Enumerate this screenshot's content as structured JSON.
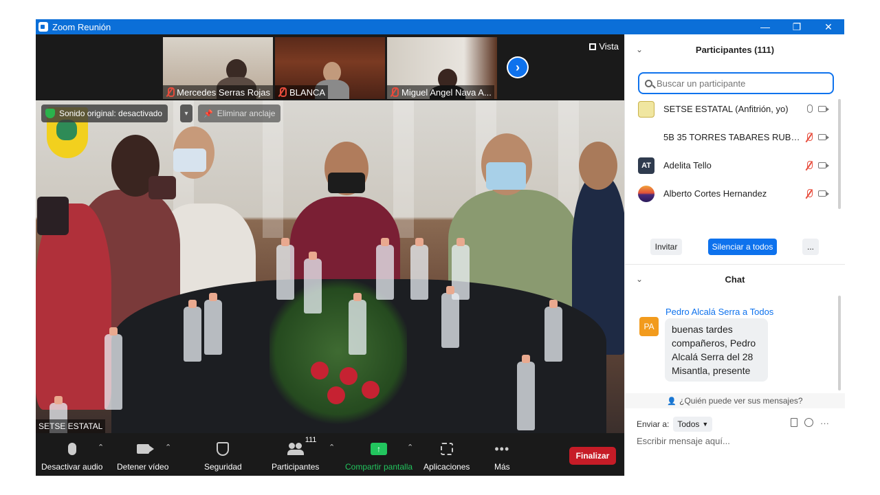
{
  "window": {
    "title": "Zoom Reunión",
    "minimize": "—",
    "maximize": "❐",
    "close": "✕"
  },
  "thumbnails": [
    {
      "name": "Mercedes Serras Rojas",
      "muted": true
    },
    {
      "name": "BLANCA",
      "muted": true
    },
    {
      "name": "Miguel Angel Nava A...",
      "muted": true
    }
  ],
  "next_arrow": "›",
  "view_label": "Vista",
  "stage": {
    "sound_chip": "Sonido original: desactivado",
    "sound_caret": "▾",
    "unpin_label": "Eliminar anclaje",
    "speaker_name": "SETSE ESTATAL"
  },
  "toolbar": {
    "audio_label": "Desactivar audio",
    "video_label": "Detener vídeo",
    "security_label": "Seguridad",
    "participants_label": "Participantes",
    "participants_count": "111",
    "share_label": "Compartir pantalla",
    "share_glyph": "↑",
    "apps_label": "Aplicaciones",
    "more_label": "Más",
    "more_glyph": "•••",
    "end_label": "Finalizar",
    "caret": "⌃",
    "colors": {
      "share": "#22c55e",
      "end": "#c61c27"
    }
  },
  "participants_panel": {
    "title": "Participantes (111)",
    "search_placeholder": "Buscar un participante",
    "list": [
      {
        "name": "SETSE ESTATAL (Anfitrión, yo)",
        "avatar_type": "logo",
        "mic": "on",
        "video": "off"
      },
      {
        "name": "5B 35 TORRES TABARES RUBEN ...",
        "avatar_type": "none",
        "mic": "muted",
        "video": "off"
      },
      {
        "name": "Adelita Tello",
        "avatar_type": "initials",
        "initials": "AT",
        "mic": "muted",
        "video": "off"
      },
      {
        "name": "Alberto Cortes Hernandez",
        "avatar_type": "image",
        "mic": "muted",
        "video": "off"
      }
    ],
    "invite_label": "Invitar",
    "mute_all_label": "Silenciar a todos",
    "more_label": "..."
  },
  "chat_panel": {
    "title": "Chat",
    "messages": [
      {
        "sender": "Pedro Alcalá Serra a Todos",
        "avatar_initials": "PA",
        "text": "buenas tardes compañeros, Pedro Alcalá Serra del 28 Misantla, presente"
      }
    ],
    "who_can_see": "¿Quién puede ver sus mensajes?",
    "send_to_label": "Enviar a:",
    "send_to_value": "Todos",
    "more_glyph": "···",
    "input_placeholder": "Escribir mensaje aquí..."
  }
}
